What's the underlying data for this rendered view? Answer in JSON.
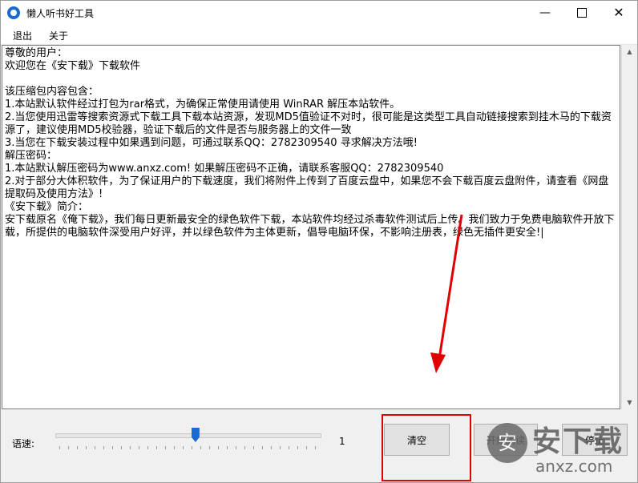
{
  "window": {
    "title": "懒人听书好工具"
  },
  "controls": {
    "minimize": "—",
    "maximize": "",
    "close": "✕"
  },
  "menu": {
    "exit": "退出",
    "about": "关于"
  },
  "content": {
    "text": "尊敬的用户：\n欢迎您在《安下载》下载软件\n\n该压缩包内容包含：\n1.本站默认软件经过打包为rar格式，为确保正常使用请使用 WinRAR 解压本站软件。\n2.当您使用迅雷等搜索资源式下载工具下载本站资源，发现MD5值验证不对时，很可能是这类型工具自动链接搜索到挂木马的下载资源了，建议使用MD5校验器，验证下载后的文件是否与服务器上的文件一致\n3.当您在下载安装过程中如果遇到问题，可通过联系QQ：2782309540 寻求解决方法哦!\n解压密码：\n1.本站默认解压密码为www.anxz.com! 如果解压密码不正确，请联系客服QQ：2782309540\n2.对于部分大体积软件，为了保证用户的下载速度，我们将附件上传到了百度云盘中，如果您不会下载百度云盘附件，请查看《网盘提取码及使用方法》!\n《安下载》简介：\n安下载原名《俺下载》，我们每日更新最安全的绿色软件下载，本站软件均经过杀毒软件测试后上传。我们致力于免费电脑软件开放下载，所提供的电脑软件深受用户好评，并以绿色软件为主体更新，倡导电脑环保，不影响注册表，绿色无插件更安全!|"
  },
  "speed": {
    "label": "语速:",
    "value": "1",
    "slider_fraction": 0.53
  },
  "buttons": {
    "clear": "清空",
    "read": "开始朗读",
    "stop": "停止"
  },
  "watermark": {
    "text": "安下载",
    "domain": "anxz.com",
    "logo": "安"
  },
  "annotation": {
    "color": "#e00000"
  }
}
